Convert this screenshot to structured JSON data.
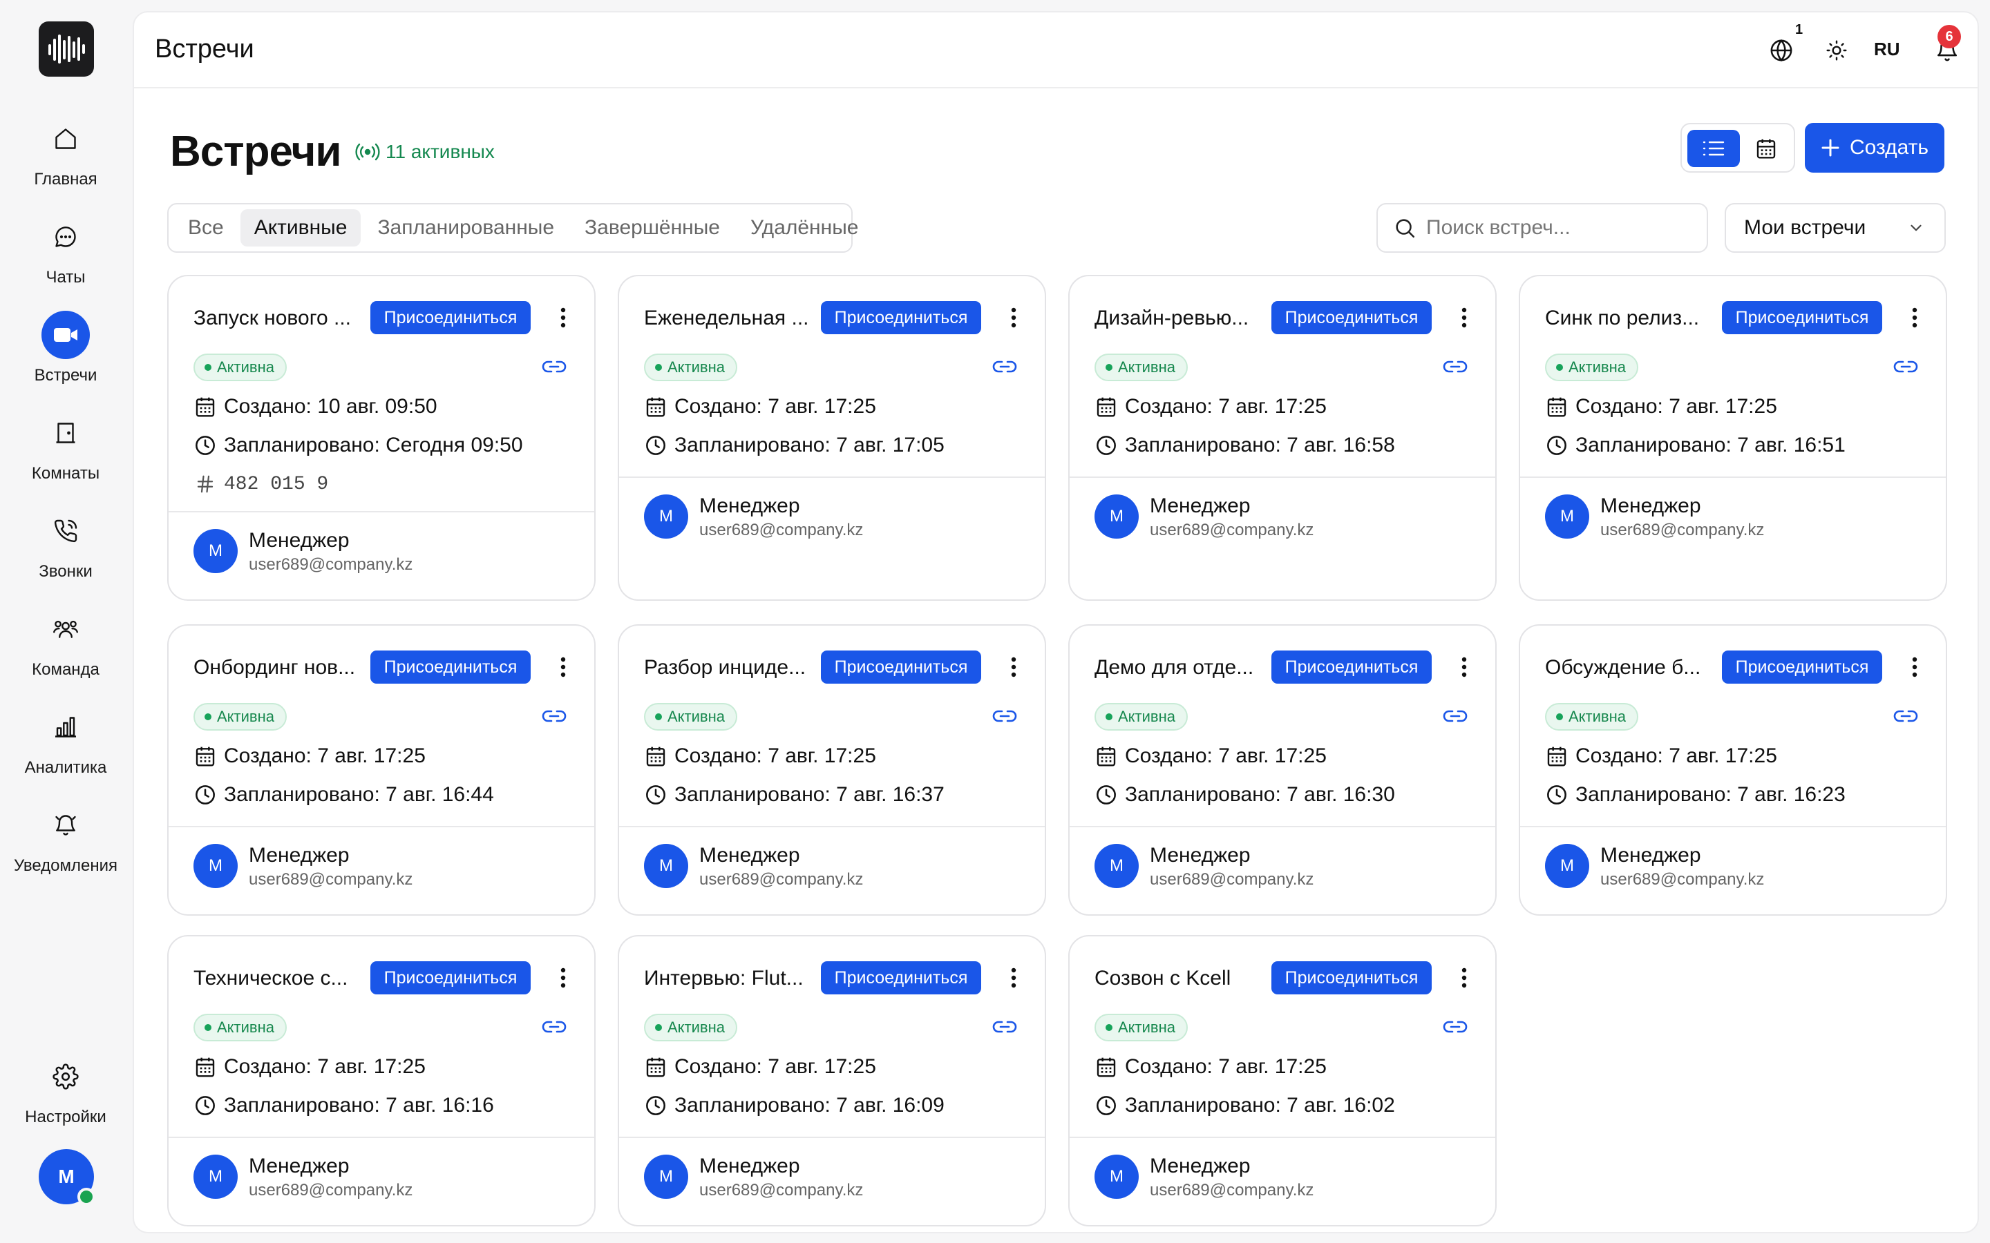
{
  "nav": [
    {
      "label": "Главная",
      "icon": "home-icon"
    },
    {
      "label": "Чаты",
      "icon": "chat-icon"
    },
    {
      "label": "Встречи",
      "icon": "video-camera-icon",
      "active": true
    },
    {
      "label": "Комнаты",
      "icon": "door-icon"
    },
    {
      "label": "Звонки",
      "icon": "phone-icon"
    },
    {
      "label": "Команда",
      "icon": "team-icon"
    },
    {
      "label": "Аналитика",
      "icon": "bar-chart-icon"
    },
    {
      "label": "Уведомления",
      "icon": "bell-icon"
    }
  ],
  "settings_label": "Настройки",
  "user_initial": "M",
  "header": {
    "title": "Встречи",
    "globe_count": "1",
    "lang": "RU",
    "notif_count": "6"
  },
  "page": {
    "title": "Встречи",
    "active_count": "11 активных",
    "create_label": "Создать"
  },
  "tabs": [
    {
      "label": "Все",
      "active": false
    },
    {
      "label": "Активные",
      "active": true
    },
    {
      "label": "Запланированные",
      "active": false
    },
    {
      "label": "Завершённые",
      "active": false
    },
    {
      "label": "Удалённые",
      "active": false
    }
  ],
  "search": {
    "placeholder": "Поиск встреч..."
  },
  "filter": {
    "selected": "Мои встречи"
  },
  "labels": {
    "join": "Присоединиться",
    "status": "Активна"
  },
  "colors": {
    "accent": "#1a56e8",
    "status_green": "#17884e",
    "badge_red": "#e5333a"
  },
  "meetings": [
    {
      "title": "Запуск нового ...",
      "created": "Создано: 10 авг. 09:50",
      "scheduled": "Запланировано: Сегодня 09:50",
      "code": "482 015 9",
      "organizer": "Менеджер",
      "email": "user689@company.kz",
      "initial": "M"
    },
    {
      "title": "Еженедельная ...",
      "created": "Создано: 7 авг. 17:25",
      "scheduled": "Запланировано: 7 авг. 17:05",
      "organizer": "Менеджер",
      "email": "user689@company.kz",
      "initial": "M"
    },
    {
      "title": "Дизайн-ревью...",
      "created": "Создано: 7 авг. 17:25",
      "scheduled": "Запланировано: 7 авг. 16:58",
      "organizer": "Менеджер",
      "email": "user689@company.kz",
      "initial": "M"
    },
    {
      "title": "Синк по релиз...",
      "created": "Создано: 7 авг. 17:25",
      "scheduled": "Запланировано: 7 авг. 16:51",
      "organizer": "Менеджер",
      "email": "user689@company.kz",
      "initial": "M"
    },
    {
      "title": "Онбординг нов...",
      "created": "Создано: 7 авг. 17:25",
      "scheduled": "Запланировано: 7 авг. 16:44",
      "organizer": "Менеджер",
      "email": "user689@company.kz",
      "initial": "M"
    },
    {
      "title": "Разбор инциде...",
      "created": "Создано: 7 авг. 17:25",
      "scheduled": "Запланировано: 7 авг. 16:37",
      "organizer": "Менеджер",
      "email": "user689@company.kz",
      "initial": "M"
    },
    {
      "title": "Демо для отде...",
      "created": "Создано: 7 авг. 17:25",
      "scheduled": "Запланировано: 7 авг. 16:30",
      "organizer": "Менеджер",
      "email": "user689@company.kz",
      "initial": "M"
    },
    {
      "title": "Обсуждение б...",
      "created": "Создано: 7 авг. 17:25",
      "scheduled": "Запланировано: 7 авг. 16:23",
      "organizer": "Менеджер",
      "email": "user689@company.kz",
      "initial": "M"
    },
    {
      "title": "Техническое с...",
      "created": "Создано: 7 авг. 17:25",
      "scheduled": "Запланировано: 7 авг. 16:16",
      "organizer": "Менеджер",
      "email": "user689@company.kz",
      "initial": "M"
    },
    {
      "title": "Интервью: Flut...",
      "created": "Создано: 7 авг. 17:25",
      "scheduled": "Запланировано: 7 авг. 16:09",
      "organizer": "Менеджер",
      "email": "user689@company.kz",
      "initial": "M"
    },
    {
      "title": "Созвон с Kcell",
      "created": "Создано: 7 авг. 17:25",
      "scheduled": "Запланировано: 7 авг. 16:02",
      "organizer": "Менеджер",
      "email": "user689@company.kz",
      "initial": "M"
    }
  ]
}
